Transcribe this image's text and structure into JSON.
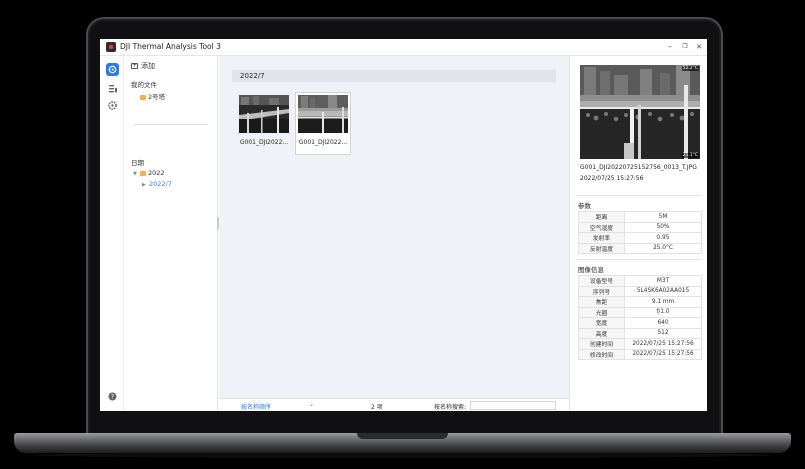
{
  "window": {
    "title": "DJI Thermal Analysis Tool 3",
    "minimize": "–",
    "restore": "❐",
    "close": "✕"
  },
  "rail": {
    "icons": [
      "image-library-icon",
      "list-icon",
      "settings-icon",
      "help-icon"
    ]
  },
  "folders": {
    "add_label": "添加",
    "my_files_label": "我的文件",
    "my_files_items": [
      "2号塔"
    ],
    "date_label": "日期",
    "year": "2022",
    "month": "2022/7"
  },
  "main": {
    "group_header": "2022/7",
    "thumbnails": [
      {
        "caption": "G001_DJI2022...",
        "selected": false
      },
      {
        "caption": "G001_DJI2022...",
        "selected": true
      }
    ]
  },
  "statusbar": {
    "sort_label": "按名称顺序",
    "count": "2 项",
    "search_label": "按名称搜索:",
    "search_value": ""
  },
  "detail": {
    "temp_max": "52.2°C",
    "temp_min": "25.1°C",
    "filename": "G001_DJI20220725152756_0013_T.JPG",
    "datetime": "2022/07/25 15:27:56",
    "params_title": "参数",
    "params": [
      {
        "key": "距离",
        "value": "5M"
      },
      {
        "key": "空气湿度",
        "value": "50%"
      },
      {
        "key": "发射率",
        "value": "0.95"
      },
      {
        "key": "反射温度",
        "value": "25.0°C"
      }
    ],
    "info_title": "图像信息",
    "info": [
      {
        "key": "设备型号",
        "value": "M3T"
      },
      {
        "key": "序列号",
        "value": "5L4SK6A02AA015"
      },
      {
        "key": "焦距",
        "value": "9.1 mm"
      },
      {
        "key": "光圈",
        "value": "f/1.0"
      },
      {
        "key": "宽度",
        "value": "640"
      },
      {
        "key": "高度",
        "value": "512"
      },
      {
        "key": "创建时间",
        "value": "2022/07/25 15:27:56"
      },
      {
        "key": "修改时间",
        "value": "2022/07/25 15:27:56"
      }
    ]
  }
}
